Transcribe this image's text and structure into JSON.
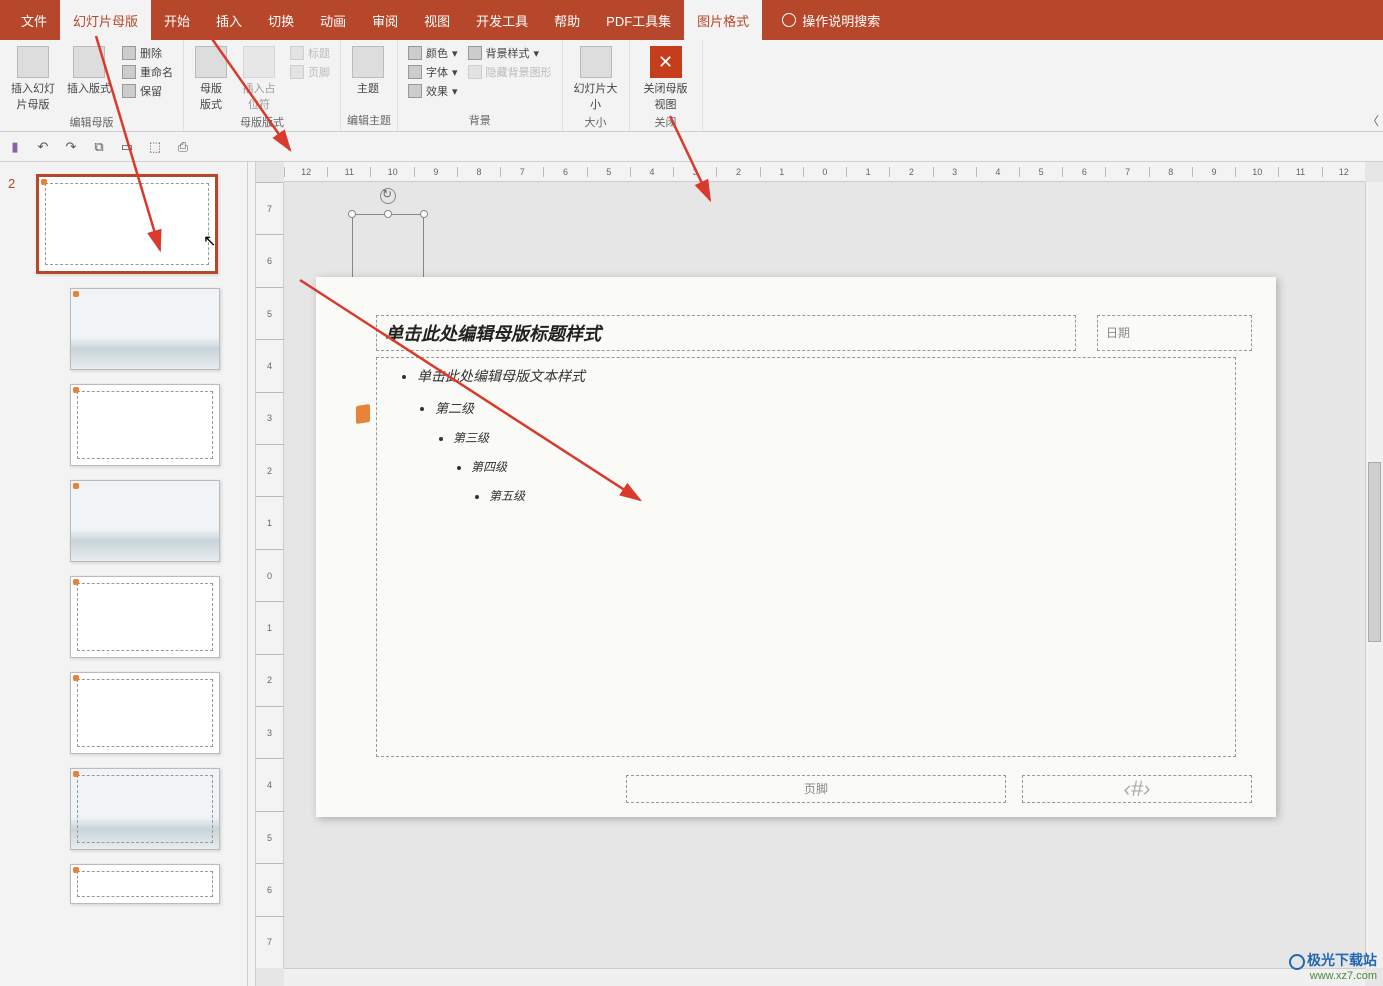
{
  "tabs": {
    "file": "文件",
    "slidemaster": "幻灯片母版",
    "home": "开始",
    "insert": "插入",
    "transition": "切换",
    "animation": "动画",
    "review": "审阅",
    "view": "视图",
    "devtools": "开发工具",
    "help": "帮助",
    "pdfkit": "PDF工具集",
    "picformat": "图片格式",
    "search": "操作说明搜索"
  },
  "ribbon": {
    "insert_slidemaster": "插入幻灯片母版",
    "insert_layout": "插入版式",
    "delete": "删除",
    "rename": "重命名",
    "preserve": "保留",
    "group_editmaster": "编辑母版",
    "master_layout": "母版版式",
    "insert_placeholder": "插入占位符",
    "chk_title": "标题",
    "chk_footer": "页脚",
    "group_masterlayout": "母版版式",
    "theme": "主题",
    "group_edittheme": "编辑主题",
    "colors": "颜色",
    "fonts": "字体",
    "effects": "效果",
    "bgstyle": "背景样式",
    "hidebg": "隐藏背景图形",
    "group_bg": "背景",
    "slidesize": "幻灯片大小",
    "group_size": "大小",
    "close_master": "关闭母版视图",
    "group_close": "关闭"
  },
  "ruler_h": [
    "12",
    "11",
    "10",
    "9",
    "8",
    "7",
    "6",
    "5",
    "4",
    "3",
    "2",
    "1",
    "0",
    "1",
    "2",
    "3",
    "4",
    "5",
    "6",
    "7",
    "8",
    "9",
    "10",
    "11",
    "12"
  ],
  "ruler_v": [
    "7",
    "6",
    "5",
    "4",
    "3",
    "2",
    "1",
    "0",
    "1",
    "2",
    "3",
    "4",
    "5",
    "6",
    "7"
  ],
  "slide": {
    "title_hint": "单击此处编辑母版标题样式",
    "body_l1": "单击此处编辑母版文本样式",
    "body_l2": "第二级",
    "body_l3": "第三级",
    "body_l4": "第四级",
    "body_l5": "第五级",
    "date_hint": "日期",
    "footer_hint": "页脚",
    "pagenum_hint": "‹#›"
  },
  "thumb_index": "2",
  "watermark": {
    "cn": "极光下载站",
    "url": "www.xz7.com"
  }
}
